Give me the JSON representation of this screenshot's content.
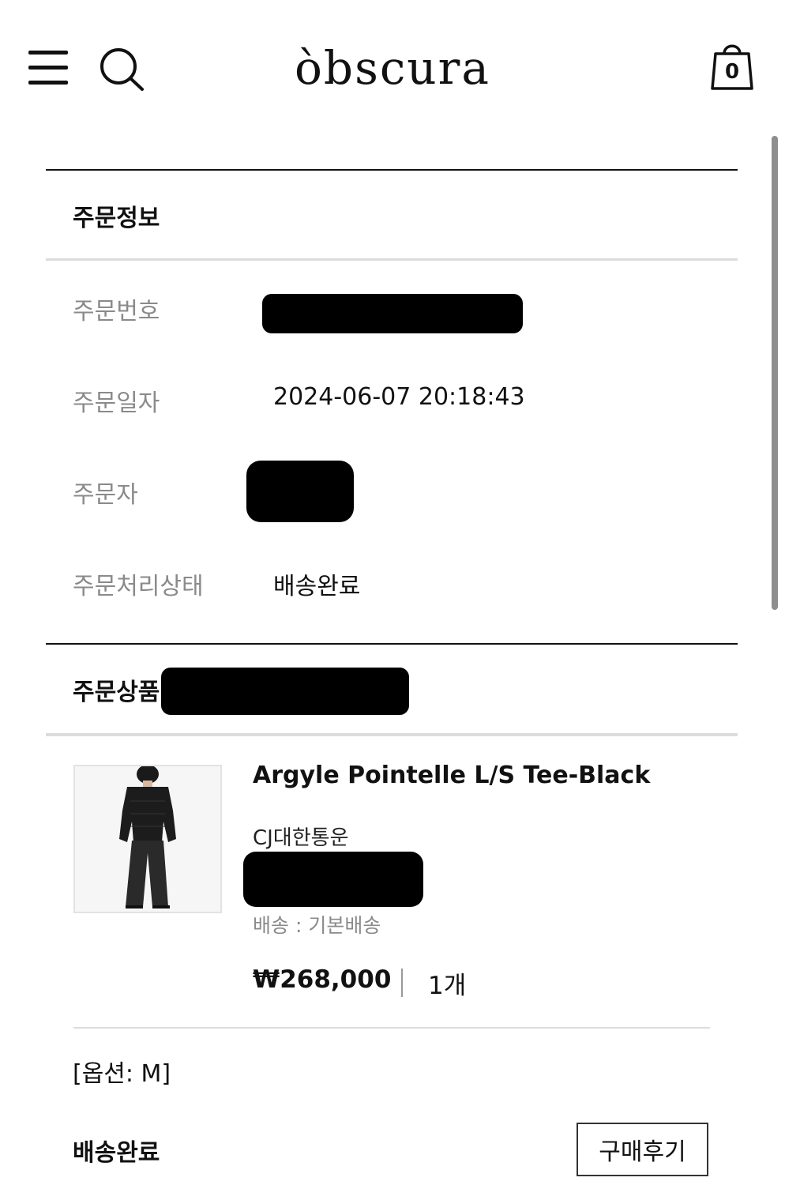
{
  "header": {
    "logo": "òbscura",
    "cart_count": "0",
    "icons": [
      "menu-icon",
      "search-icon",
      "shopping-bag-icon"
    ]
  },
  "order_info": {
    "title": "주문정보",
    "fields": [
      {
        "label": "주문번호",
        "value": ""
      },
      {
        "label": "주문일자",
        "value": "2024-06-07 20:18:43"
      },
      {
        "label": "주문자",
        "value": ""
      },
      {
        "label": "주문처리상태",
        "value": "배송완료"
      }
    ]
  },
  "order_items": {
    "title": "주문상품 (",
    "product": {
      "name": "Argyle Pointelle L/S Tee-Black",
      "carrier": "CJ대한통운",
      "shipping": "배송 : 기본배송",
      "price": "₩268,000",
      "quantity": "1개",
      "option": "[옵션: M]",
      "status": "배송완료",
      "review_button": "구매후기"
    }
  }
}
